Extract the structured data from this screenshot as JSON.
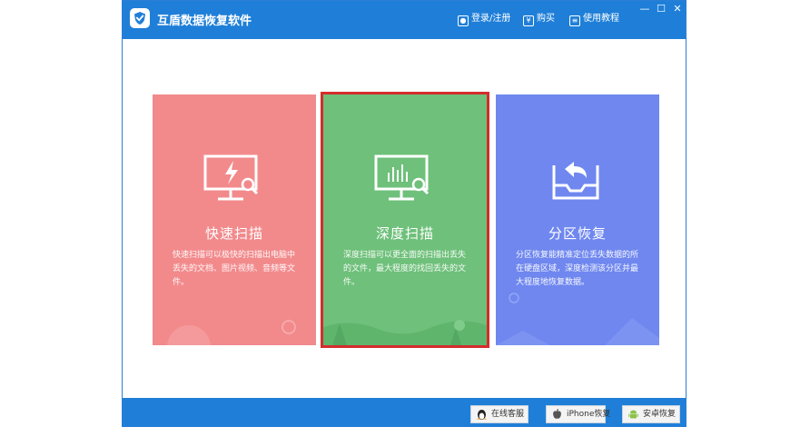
{
  "app": {
    "title": "互盾数据恢复软件",
    "brand_color": "#1f7fd8"
  },
  "topbar": {
    "login_label": "登录/注册",
    "buy_label": "购买",
    "tutorial_label": "使用教程",
    "minimize_glyph": "—",
    "maximize_glyph": "☐",
    "close_glyph": "✕"
  },
  "cards": [
    {
      "title": "快速扫描",
      "description": "快速扫描可以极快的扫描出电脑中丢失的文档、图片视频、音频等文件。",
      "icon": "monitor-lightning-icon",
      "color": "#f28a8c"
    },
    {
      "title": "深度扫描",
      "description": "深度扫描可以更全面的扫描出丢失的文件，最大程度的找回丢失的文件。",
      "icon": "monitor-chart-icon",
      "color": "#6ec07a",
      "selected": true
    },
    {
      "title": "分区恢复",
      "description": "分区恢复能精准定位丢失数据的所在硬盘区域，深度检测该分区并最大程度地恢复数据。",
      "icon": "tray-restore-icon",
      "color": "#6f87ef"
    }
  ],
  "bottombar": {
    "online_service_label": "在线客服",
    "iphone_recovery_label": "iPhone恢复",
    "android_recovery_label": "安卓恢复"
  }
}
